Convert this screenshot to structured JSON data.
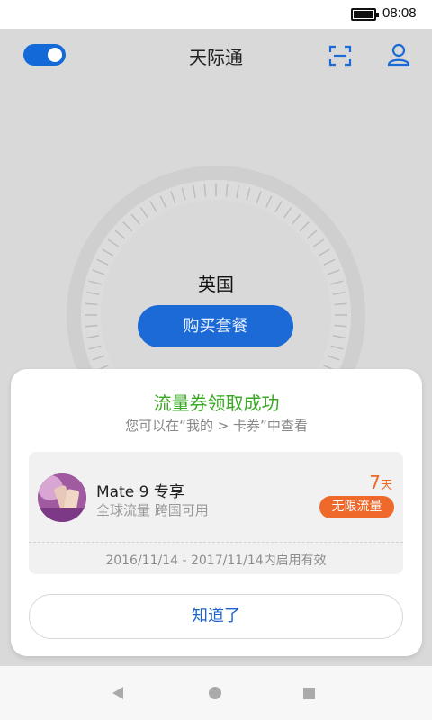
{
  "status_bar": {
    "time": "08:08"
  },
  "header": {
    "title": "天际通"
  },
  "main": {
    "country": "英国",
    "buy_button": "购买套餐"
  },
  "modal": {
    "title": "流量券领取成功",
    "subtitle": "您可以在“我的 > 卡券”中查看",
    "coupon": {
      "name": "Mate 9 专享",
      "description": "全球流量 跨国可用",
      "days": "7",
      "days_unit": "天",
      "badge": "无限流量",
      "validity": "2016/11/14 - 2017/11/14内启用有效"
    },
    "confirm_button": "知道了"
  },
  "colors": {
    "accent": "#1b6ad6",
    "success": "#39a823",
    "orange": "#ef6a2a"
  }
}
